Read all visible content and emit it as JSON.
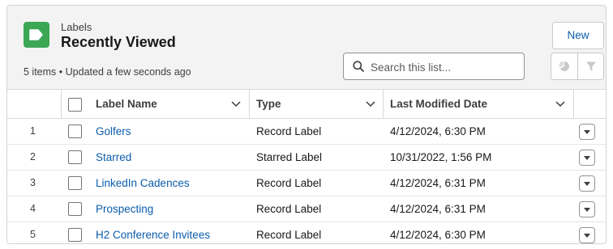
{
  "header": {
    "object_label": "Labels",
    "view_title": "Recently Viewed",
    "item_count": "5 items",
    "separator": "•",
    "updated_text": "Updated a few seconds ago",
    "new_button": "New",
    "search_placeholder": "Search this list...",
    "icon": "label-tag-icon",
    "accent_color": "#3ba755"
  },
  "table": {
    "columns": [
      "Label Name",
      "Type",
      "Last Modified Date"
    ],
    "rows": [
      {
        "num": "1",
        "name": "Golfers",
        "type": "Record Label",
        "modified": "4/12/2024, 6:30 PM"
      },
      {
        "num": "2",
        "name": "Starred",
        "type": "Starred Label",
        "modified": "10/31/2022, 1:56 PM"
      },
      {
        "num": "3",
        "name": "LinkedIn Cadences",
        "type": "Record Label",
        "modified": "4/12/2024, 6:31 PM"
      },
      {
        "num": "4",
        "name": "Prospecting",
        "type": "Record Label",
        "modified": "4/12/2024, 6:31 PM"
      },
      {
        "num": "5",
        "name": "H2 Conference Invitees",
        "type": "Record Label",
        "modified": "4/12/2024, 6:30 PM"
      }
    ]
  },
  "icons": {
    "search": "search-icon",
    "chart": "pie-chart-icon",
    "filter": "filter-icon",
    "column_menu": "chevron-down-icon",
    "row_menu": "row-actions-icon"
  },
  "colors": {
    "link": "#0b5cab",
    "header_bg": "#f3f3f3"
  }
}
